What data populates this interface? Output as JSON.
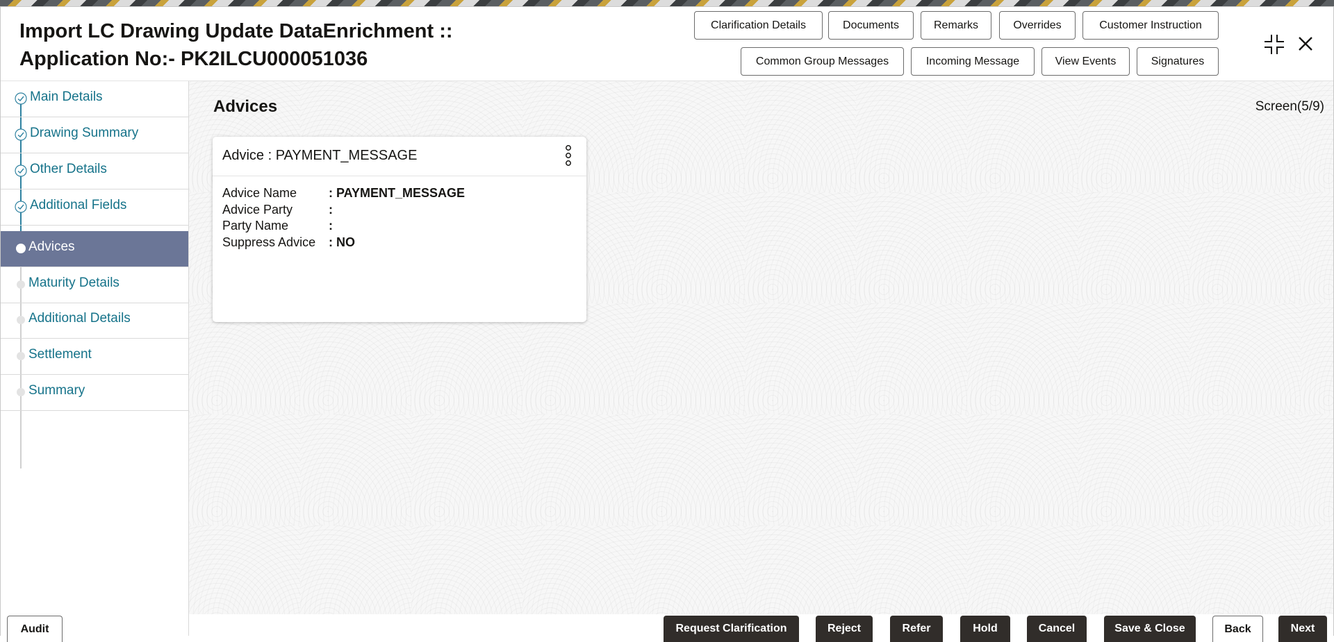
{
  "header": {
    "title_line1": "Import LC Drawing Update DataEnrichment ::",
    "title_line2": "Application No:- PK2ILCU000051036",
    "buttons_row1": [
      "Clarification Details",
      "Documents",
      "Remarks",
      "Overrides",
      "Customer Instruction"
    ],
    "buttons_row2": [
      "Common Group Messages",
      "Incoming Message",
      "View Events",
      "Signatures"
    ]
  },
  "sidebar": {
    "items": [
      {
        "label": "Main Details",
        "state": "complete"
      },
      {
        "label": "Drawing Summary",
        "state": "complete"
      },
      {
        "label": "Other Details",
        "state": "complete"
      },
      {
        "label": "Additional Fields",
        "state": "complete"
      },
      {
        "label": "Advices",
        "state": "active"
      },
      {
        "label": "Maturity Details",
        "state": "pending"
      },
      {
        "label": "Additional Details",
        "state": "pending"
      },
      {
        "label": "Settlement",
        "state": "pending"
      },
      {
        "label": "Summary",
        "state": "pending"
      }
    ]
  },
  "main": {
    "section_title": "Advices",
    "screen_indicator": "Screen(5/9)",
    "card": {
      "title": "Advice : PAYMENT_MESSAGE",
      "fields": [
        {
          "label": "Advice Name",
          "value": ": PAYMENT_MESSAGE"
        },
        {
          "label": "Advice Party",
          "value": ":"
        },
        {
          "label": "Party Name",
          "value": ":"
        },
        {
          "label": "Suppress Advice",
          "value": ": NO"
        }
      ]
    }
  },
  "footer": {
    "audit": "Audit",
    "request_clarification": "Request Clarification",
    "reject": "Reject",
    "refer": "Refer",
    "hold": "Hold",
    "cancel": "Cancel",
    "save_close": "Save & Close",
    "back": "Back",
    "next": "Next"
  },
  "colors": {
    "active_nav_bg": "#6b7697",
    "nav_link": "#16738a",
    "dark_button": "#312d2a"
  }
}
